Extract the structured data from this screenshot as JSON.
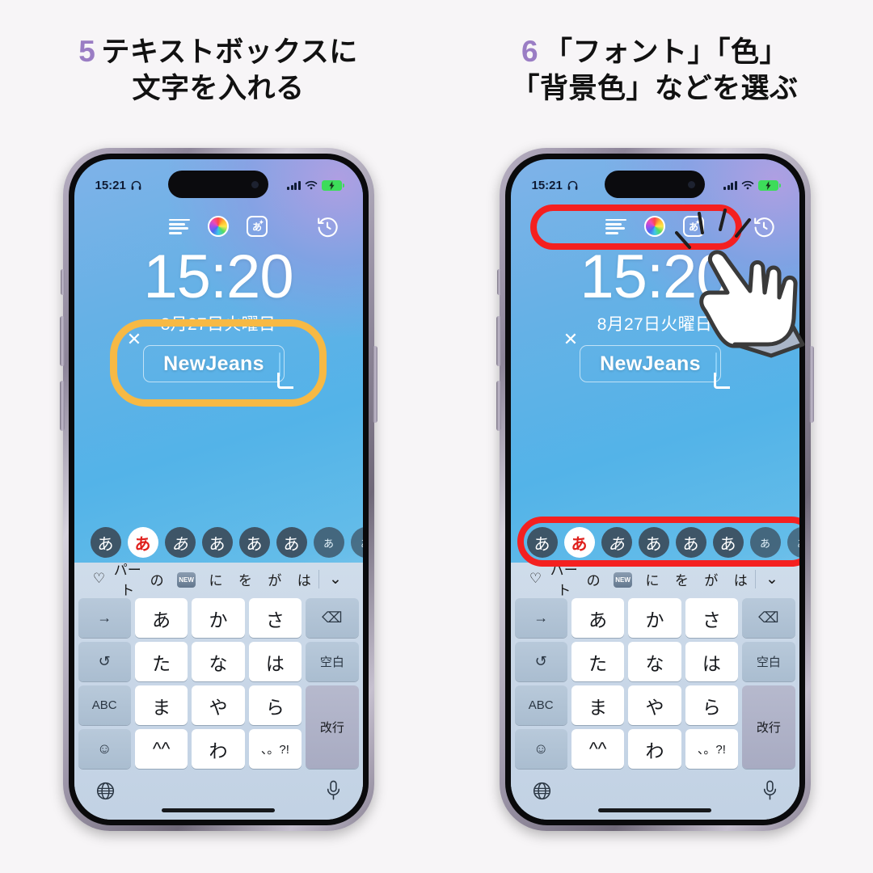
{
  "page": {
    "background_color": "#f7f5f7",
    "step_number_color": "#9a7dc4",
    "highlight_orange": "#f7b944",
    "highlight_red": "#f42020"
  },
  "steps": [
    {
      "number": "5",
      "title_line1": "テキストボックスに",
      "title_line2": "文字を入れる"
    },
    {
      "number": "6",
      "title_line1": "「フォント」「色」",
      "title_line2": "「背景色」などを選ぶ"
    }
  ],
  "phone": {
    "status_bar": {
      "time": "15:21",
      "headphone_icon": "headphone-icon",
      "signal_icon": "cellular-bars-icon",
      "wifi_icon": "wifi-icon",
      "battery_icon": "battery-charging-icon",
      "battery_color": "#3ddc5a"
    },
    "toolbar": {
      "align_icon": "text-align-left-icon",
      "color_icon": "color-wheel-icon",
      "effects_icon": "text-effects-icon",
      "effects_glyph": "あ",
      "history_icon": "history-undo-icon"
    },
    "lock_screen": {
      "time": "15:20",
      "date": "8月27日火曜日",
      "text_widget": {
        "value": "NewJeans",
        "close_icon": "close-x-icon",
        "resize_handle": "resize-corner-handle"
      }
    },
    "font_row": {
      "items": [
        {
          "glyph": "あ",
          "selected": false,
          "style": "rounded"
        },
        {
          "glyph": "あ",
          "selected": true,
          "style": "bold-red"
        },
        {
          "glyph": "あ",
          "selected": false,
          "style": "italic"
        },
        {
          "glyph": "あ",
          "selected": false,
          "style": "brush"
        },
        {
          "glyph": "あ",
          "selected": false,
          "style": "thin"
        },
        {
          "glyph": "あ",
          "selected": false,
          "style": "serif"
        },
        {
          "glyph": "あ",
          "selected": false,
          "style": "small"
        },
        {
          "glyph": "あ",
          "selected": false,
          "style": "clipped"
        }
      ]
    },
    "keyboard": {
      "predictive": {
        "heart_icon": "heart-icon",
        "items": [
          "パート",
          "の",
          "NEW",
          "に",
          "を",
          "が",
          "は"
        ],
        "new_badge": "NEW",
        "collapse_icon": "chevron-down-icon"
      },
      "rows": [
        [
          {
            "label": "→",
            "type": "fn",
            "name": "cursor-right-key"
          },
          {
            "label": "あ",
            "type": "char",
            "name": "key-a"
          },
          {
            "label": "か",
            "type": "char",
            "name": "key-ka"
          },
          {
            "label": "さ",
            "type": "char",
            "name": "key-sa"
          },
          {
            "label": "⌫",
            "type": "fn",
            "name": "backspace-key"
          }
        ],
        [
          {
            "label": "↺",
            "type": "fn",
            "name": "undo-key"
          },
          {
            "label": "た",
            "type": "char",
            "name": "key-ta"
          },
          {
            "label": "な",
            "type": "char",
            "name": "key-na"
          },
          {
            "label": "は",
            "type": "char",
            "name": "key-ha"
          },
          {
            "label": "空白",
            "type": "fn",
            "name": "space-key"
          }
        ],
        [
          {
            "label": "ABC",
            "type": "fn",
            "name": "abc-key"
          },
          {
            "label": "ま",
            "type": "char",
            "name": "key-ma"
          },
          {
            "label": "や",
            "type": "char",
            "name": "key-ya"
          },
          {
            "label": "ら",
            "type": "char",
            "name": "key-ra"
          },
          {
            "label": "改行",
            "type": "ret",
            "name": "return-key"
          }
        ],
        [
          {
            "label": "☺",
            "type": "fn",
            "name": "emoji-key"
          },
          {
            "label": "^^",
            "type": "char",
            "name": "key-kaomoji"
          },
          {
            "label": "わ",
            "type": "char",
            "name": "key-wa"
          },
          {
            "label": "、。?!",
            "type": "char",
            "name": "key-punctuation"
          }
        ]
      ],
      "bottom": {
        "globe_icon": "globe-icon",
        "mic_icon": "microphone-icon"
      }
    }
  },
  "annotations": {
    "left_phone": {
      "orange_ring_target": "text-widget"
    },
    "right_phone": {
      "red_ring_toolbar_target": "lock-toolbar-icons",
      "red_ring_fonts_target": "font-selector-row",
      "hand_cursor": "pointing-hand-cursor",
      "tap_burst": "tap-burst-lines"
    }
  }
}
